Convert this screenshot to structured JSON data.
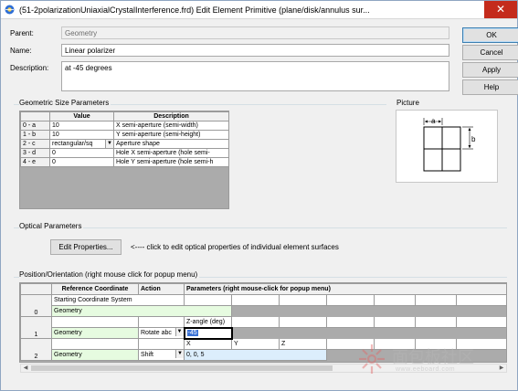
{
  "window": {
    "title": "(51-2polarizationUniaxialCrystalInterference.frd) Edit Element Primitive (plane/disk/annulus sur...",
    "close_glyph": "✕"
  },
  "form": {
    "parent_label": "Parent:",
    "parent_value": "Geometry",
    "name_label": "Name:",
    "name_value": "Linear polarizer",
    "description_label": "Description:",
    "description_value": "at -45 degrees"
  },
  "buttons": {
    "ok": "OK",
    "cancel": "Cancel",
    "apply": "Apply",
    "help": "Help"
  },
  "geometric": {
    "title": "Geometric Size Parameters",
    "columns": [
      "",
      "Value",
      "Description"
    ],
    "rows": [
      {
        "id": "0 - a",
        "value": "10",
        "description": "X semi-aperture (semi-width)"
      },
      {
        "id": "1 - b",
        "value": "10",
        "description": "Y semi-aperture (semi-height)"
      },
      {
        "id": "2 - c",
        "value": "rectangular/sq",
        "description": "Aperture shape"
      },
      {
        "id": "3 - d",
        "value": "0",
        "description": "Hole X semi-aperture (hole semi-"
      },
      {
        "id": "4 - e",
        "value": "0",
        "description": "Hole Y semi-aperture (hole semi-h"
      }
    ]
  },
  "picture": {
    "title": "Picture",
    "label_a": "a",
    "label_b": "b"
  },
  "optical": {
    "title": "Optical Parameters",
    "button": "Edit Properties...",
    "hint": "<---- click to edit optical properties of individual element surfaces"
  },
  "position": {
    "title": "Position/Orientation  (right mouse click for popup menu)",
    "headers": {
      "ref": "Reference Coordinate",
      "action": "Action",
      "params": "Parameters (right mouse-click for popup menu)"
    },
    "rows": [
      {
        "num": "0",
        "top": "Starting Coordinate System",
        "ref": "Geometry"
      },
      {
        "num": "1",
        "ref": "Geometry",
        "action": "Rotate abc",
        "param_label": "Z-angle (deg)",
        "param_value": "-45"
      },
      {
        "num": "2",
        "ref": "Geometry",
        "action": "Shift",
        "col_labels": [
          "X",
          "Y",
          "Z"
        ],
        "param_value": "0,  0,  5"
      }
    ]
  },
  "watermark": {
    "text": "面包板社区",
    "url": "www.eeboard.com"
  },
  "colors": {
    "green_cell": "#e6fbe0",
    "blue_cell": "#dceefc",
    "selection": "#3b73d6",
    "close_red": "#c42b1c"
  },
  "icons": {
    "app": "app-icon",
    "dropdown": "chevron-down-icon"
  }
}
